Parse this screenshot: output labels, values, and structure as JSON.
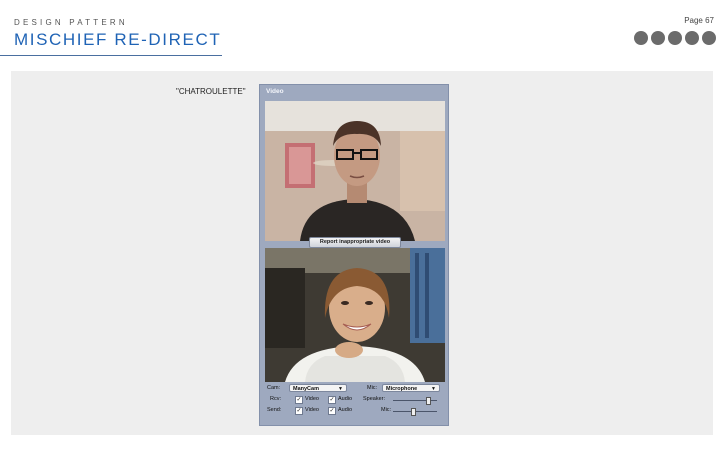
{
  "header": {
    "kicker": "DESIGN PATTERN",
    "title": "MISCHIEF RE-DIRECT",
    "page": "Page 67"
  },
  "caption": "\"CHATROULETTE\"",
  "app": {
    "title": "Video",
    "report_button": "Report inappropriate video",
    "cam_label": "Cam:",
    "cam_value": "ManyCam",
    "mic_label": "Mic:",
    "mic_value": "Microphone",
    "rcv_label": "Rcv:",
    "send_label": "Send:",
    "video_label": "Video",
    "audio_label": "Audio",
    "speaker_label": "Speaker:",
    "mic_slider_label": "Mic:",
    "rcv_video_checked": true,
    "rcv_audio_checked": true,
    "send_video_checked": true,
    "send_audio_checked": true,
    "speaker_level": 0.8,
    "mic_level": 0.45
  },
  "colors": {
    "accent": "#1f63b5",
    "dots": "#6b6b6b",
    "panel": "#eeeeee",
    "app_frame": "#9ea9bf"
  }
}
